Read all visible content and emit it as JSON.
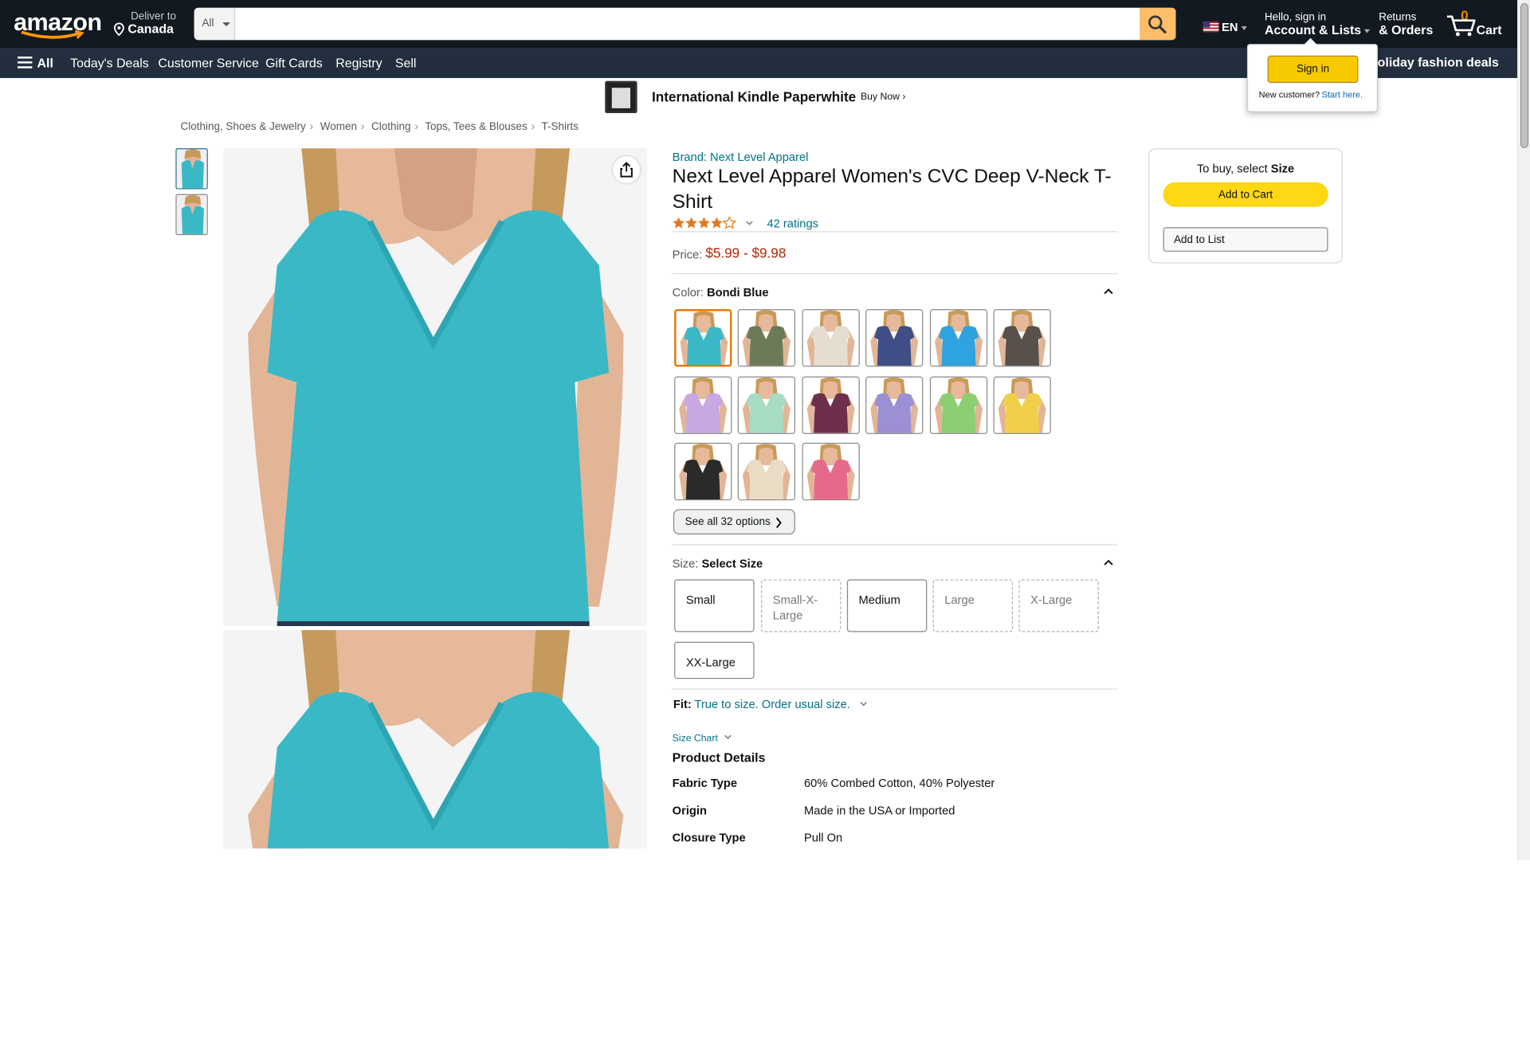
{
  "header": {
    "logo": "amazon",
    "deliver_line1": "Deliver to",
    "deliver_line2": "Canada",
    "search_category": "All",
    "search_placeholder": "",
    "language": "EN",
    "account_line1": "Hello, sign in",
    "account_line2": "Account & Lists",
    "returns_line1": "Returns",
    "returns_line2": "& Orders",
    "cart_count": "0",
    "cart_label": "Cart"
  },
  "nav": {
    "all_label": "All",
    "items": [
      "Today's Deals",
      "Customer Service",
      "Gift Cards",
      "Registry",
      "Sell"
    ],
    "promo": "Shop holiday fashion deals"
  },
  "banner": {
    "title": "International Kindle Paperwhite",
    "cta": "Buy Now ›"
  },
  "breadcrumb": [
    "Clothing, Shoes & Jewelry",
    "Women",
    "Clothing",
    "Tops, Tees & Blouses",
    "T-Shirts"
  ],
  "product": {
    "brand": "Brand: Next Level Apparel",
    "title": "Next Level Apparel Women's CVC Deep V-Neck T-Shirt",
    "rating": 4.5,
    "ratings_count": "42 ratings",
    "price_label": "Price:",
    "price": "$5.99 - $9.98",
    "color_label": "Color:",
    "color_value": "Bondi Blue",
    "swatches": [
      {
        "name": "Bondi Blue",
        "color": "#3bb8c6",
        "selected": true
      },
      {
        "name": "Military Green",
        "color": "#6d7a58"
      },
      {
        "name": "Oatmeal",
        "color": "#e4ddd0"
      },
      {
        "name": "Midnight Navy",
        "color": "#3f4e86"
      },
      {
        "name": "Turquoise",
        "color": "#2ea3df"
      },
      {
        "name": "Macchiato",
        "color": "#58504a"
      },
      {
        "name": "Lilac",
        "color": "#c7a8e3"
      },
      {
        "name": "Mint",
        "color": "#a5dcc2"
      },
      {
        "name": "Plum",
        "color": "#6e2f4c"
      },
      {
        "name": "Purple Rush",
        "color": "#9d8fd3"
      },
      {
        "name": "Kiwi",
        "color": "#8ccf73"
      },
      {
        "name": "Banana Cream",
        "color": "#f2cf4a"
      },
      {
        "name": "Black",
        "color": "#2a2a2a"
      },
      {
        "name": "Natural",
        "color": "#eadbc4"
      },
      {
        "name": "Hot Pink",
        "color": "#e56a8a"
      }
    ],
    "see_all": "See all 32 options",
    "size_label": "Size:",
    "size_value": "Select Size",
    "sizes": [
      {
        "label": "Small",
        "available": true
      },
      {
        "label": "Small-X-Large",
        "available": false
      },
      {
        "label": "Medium",
        "available": true
      },
      {
        "label": "Large",
        "available": false
      },
      {
        "label": "X-Large",
        "available": false
      },
      {
        "label": "XX-Large",
        "available": true
      }
    ],
    "fit_label": "Fit:",
    "fit_value": "True to size. Order usual size.",
    "size_chart": "Size Chart",
    "details_heading": "Product Details",
    "details": [
      {
        "key": "Fabric Type",
        "value": "60% Combed Cotton, 40% Polyester"
      },
      {
        "key": "Origin",
        "value": "Made in the USA or Imported"
      },
      {
        "key": "Closure Type",
        "value": "Pull On"
      }
    ]
  },
  "buybox": {
    "prompt_prefix": "To buy, select",
    "prompt_bold": "Size",
    "add_to_cart": "Add to Cart",
    "add_to_list": "Add to List"
  },
  "signin_popover": {
    "button": "Sign in",
    "new_customer": "New customer?",
    "start_here": "Start here."
  },
  "colors": {
    "header_bg": "#131921",
    "nav_bg": "#232f3e",
    "search_button": "#febd69",
    "cart_button": "#ffd814",
    "price": "#b12704",
    "link": "#007185",
    "shirt": "#3bb8c6"
  }
}
